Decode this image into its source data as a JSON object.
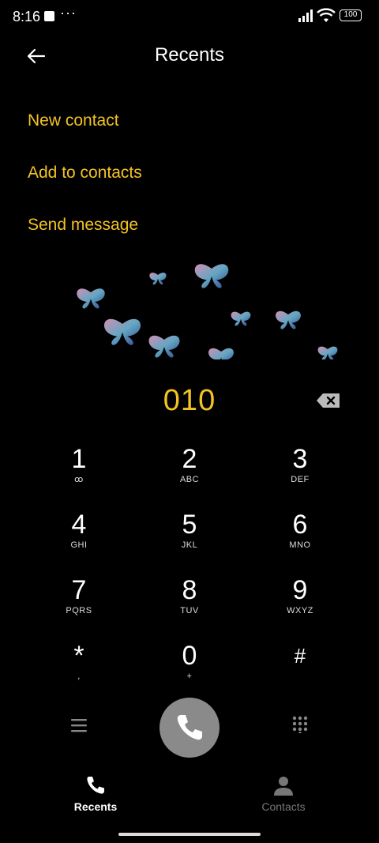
{
  "status": {
    "time": "8:16",
    "battery": "100",
    "overflow": "···"
  },
  "header": {
    "title": "Recents"
  },
  "actions": [
    "New contact",
    "Add to contacts",
    "Send message"
  ],
  "dialer": {
    "number": "010",
    "keys": [
      {
        "digit": "1",
        "letters": "ꝏ"
      },
      {
        "digit": "2",
        "letters": "ABC"
      },
      {
        "digit": "3",
        "letters": "DEF"
      },
      {
        "digit": "4",
        "letters": "GHI"
      },
      {
        "digit": "5",
        "letters": "JKL"
      },
      {
        "digit": "6",
        "letters": "MNO"
      },
      {
        "digit": "7",
        "letters": "PQRS"
      },
      {
        "digit": "8",
        "letters": "TUV"
      },
      {
        "digit": "9",
        "letters": "WXYZ"
      },
      {
        "digit": "*",
        "letters": ","
      },
      {
        "digit": "0",
        "letters": "+"
      },
      {
        "digit": "#",
        "letters": ""
      }
    ]
  },
  "bottom_nav": {
    "recents": "Recents",
    "contacts": "Contacts"
  },
  "colors": {
    "accent": "#f3c324",
    "call_button": "#8a8a8a",
    "inactive": "#777777"
  }
}
